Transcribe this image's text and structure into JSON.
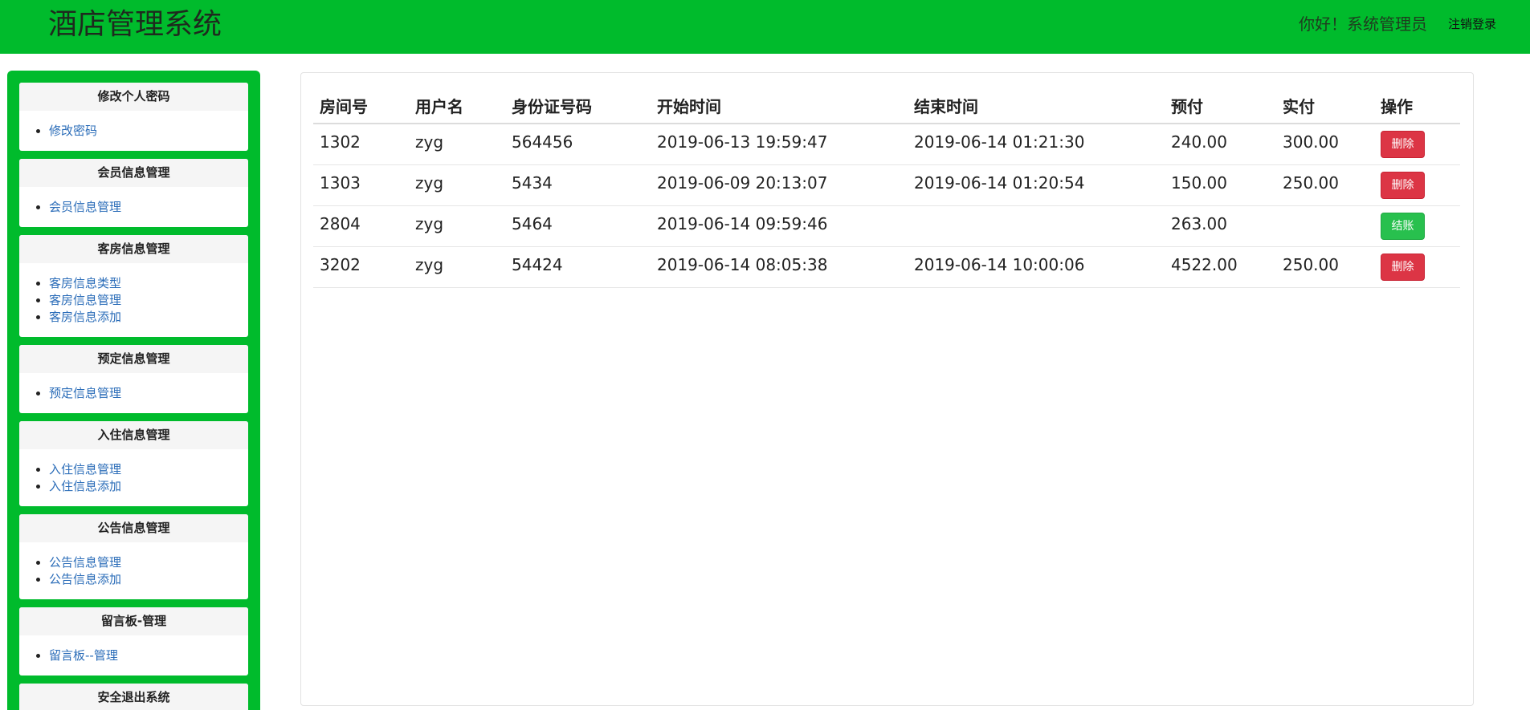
{
  "header": {
    "app_title": "酒店管理系统",
    "greeting": "你好！系统管理员",
    "logout_label": "注销登录"
  },
  "sidebar": {
    "panels": [
      {
        "title": "修改个人密码",
        "links": [
          "修改密码"
        ]
      },
      {
        "title": "会员信息管理",
        "links": [
          "会员信息管理"
        ]
      },
      {
        "title": "客房信息管理",
        "links": [
          "客房信息类型",
          "客房信息管理",
          "客房信息添加"
        ]
      },
      {
        "title": "预定信息管理",
        "links": [
          "预定信息管理"
        ]
      },
      {
        "title": "入住信息管理",
        "links": [
          "入住信息管理",
          "入住信息添加"
        ]
      },
      {
        "title": "公告信息管理",
        "links": [
          "公告信息管理",
          "公告信息添加"
        ]
      },
      {
        "title": "留言板-管理",
        "links": [
          "留言板--管理"
        ]
      },
      {
        "title": "安全退出系统",
        "links": []
      }
    ]
  },
  "table": {
    "headers": [
      "房间号",
      "用户名",
      "身份证号码",
      "开始时间",
      "结束时间",
      "预付",
      "实付",
      "操作"
    ],
    "rows": [
      {
        "room": "1302",
        "user": "zyg",
        "id_number": "564456",
        "start": "2019-06-13 19:59:47",
        "end": "2019-06-14 01:21:30",
        "prepaid": "240.00",
        "paid": "300.00",
        "action": "删除",
        "action_type": "delete"
      },
      {
        "room": "1303",
        "user": "zyg",
        "id_number": "5434",
        "start": "2019-06-09 20:13:07",
        "end": "2019-06-14 01:20:54",
        "prepaid": "150.00",
        "paid": "250.00",
        "action": "删除",
        "action_type": "delete"
      },
      {
        "room": "2804",
        "user": "zyg",
        "id_number": "5464",
        "start": "2019-06-14 09:59:46",
        "end": "",
        "prepaid": "263.00",
        "paid": "",
        "action": "结账",
        "action_type": "checkout"
      },
      {
        "room": "3202",
        "user": "zyg",
        "id_number": "54424",
        "start": "2019-06-14 08:05:38",
        "end": "2019-06-14 10:00:06",
        "prepaid": "4522.00",
        "paid": "250.00",
        "action": "删除",
        "action_type": "delete"
      }
    ]
  },
  "colors": {
    "brand_green": "#00bb2c",
    "danger": "#dc3545",
    "success": "#28c04e",
    "link": "#2a6cb8"
  }
}
